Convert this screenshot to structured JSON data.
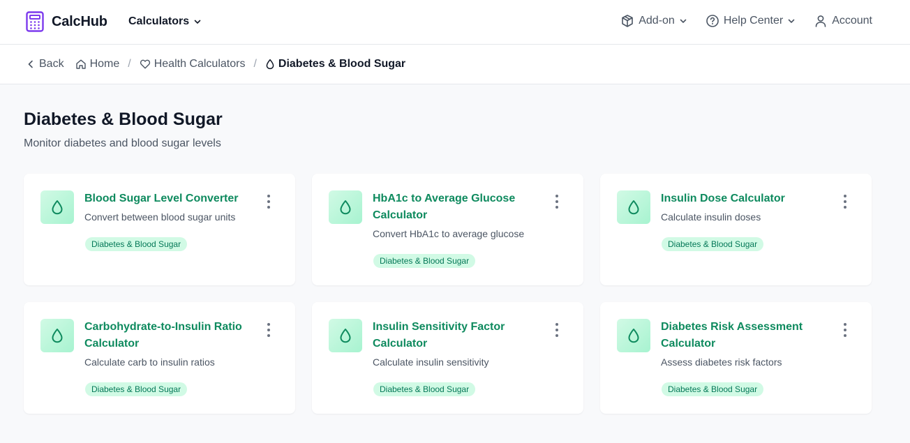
{
  "header": {
    "brand": "CalcHub",
    "calculators_label": "Calculators",
    "addon_label": "Add-on",
    "help_label": "Help Center",
    "account_label": "Account"
  },
  "breadcrumb": {
    "back": "Back",
    "home": "Home",
    "health": "Health Calculators",
    "current": "Diabetes & Blood Sugar"
  },
  "page": {
    "title": "Diabetes & Blood Sugar",
    "subtitle": "Monitor diabetes and blood sugar levels"
  },
  "colors": {
    "accent": "#0e8a5e",
    "tag_bg": "#d1fae5",
    "logo": "#7c3aed"
  },
  "cards": [
    {
      "title": "Blood Sugar Level Converter",
      "description": "Convert between blood sugar units",
      "tag": "Diabetes & Blood Sugar",
      "icon": "drop-icon"
    },
    {
      "title": "HbA1c to Average Glucose Calculator",
      "description": "Convert HbA1c to average glucose",
      "tag": "Diabetes & Blood Sugar",
      "icon": "drop-icon"
    },
    {
      "title": "Insulin Dose Calculator",
      "description": "Calculate insulin doses",
      "tag": "Diabetes & Blood Sugar",
      "icon": "drop-icon"
    },
    {
      "title": "Carbohydrate-to-Insulin Ratio Calculator",
      "description": "Calculate carb to insulin ratios",
      "tag": "Diabetes & Blood Sugar",
      "icon": "drop-icon"
    },
    {
      "title": "Insulin Sensitivity Factor Calculator",
      "description": "Calculate insulin sensitivity",
      "tag": "Diabetes & Blood Sugar",
      "icon": "drop-icon"
    },
    {
      "title": "Diabetes Risk Assessment Calculator",
      "description": "Assess diabetes risk factors",
      "tag": "Diabetes & Blood Sugar",
      "icon": "drop-icon"
    }
  ]
}
